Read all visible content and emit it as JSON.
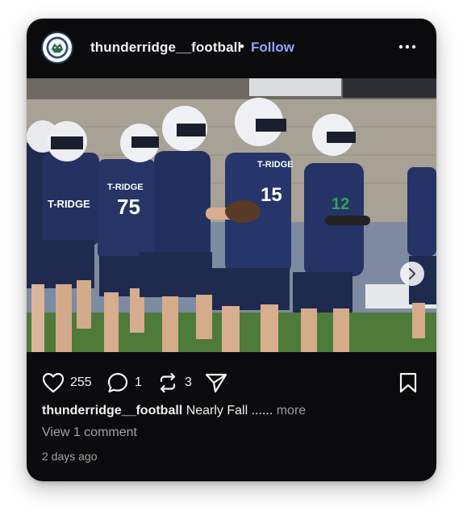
{
  "post": {
    "username": "thunderridge__football",
    "separator": "•",
    "follow_label": "Follow",
    "photo_alt": "Football team running onto field",
    "carousel": {
      "total": 4,
      "active": 0
    }
  },
  "actions": {
    "likes": "255",
    "comments": "1",
    "reposts": "3"
  },
  "caption": {
    "username": "thunderridge__football",
    "text": "Nearly Fall ......",
    "more_label": "more"
  },
  "view_comments": "View 1 comment",
  "timestamp": "2 days ago",
  "jerseys": {
    "team_text": "T-RIDGE",
    "numbers": [
      "75",
      "15",
      "12"
    ]
  },
  "colors": {
    "card_bg": "#0b0b0d",
    "follow": "#8fa4ff",
    "jersey_navy": "#1f2a4f"
  },
  "icons": [
    "avatar-logo-icon",
    "more-options-icon",
    "heart-icon",
    "comment-icon",
    "repost-icon",
    "share-icon",
    "bookmark-icon",
    "chevron-right-icon",
    "user-tag-icon"
  ]
}
